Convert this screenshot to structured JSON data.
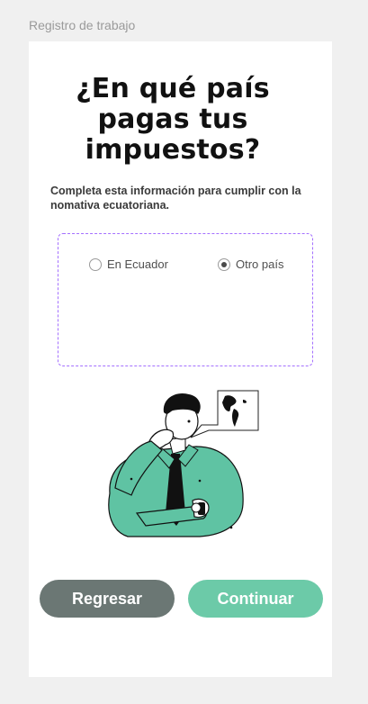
{
  "frame": {
    "label": "Registro de trabajo"
  },
  "screen": {
    "title": "¿En qué país pagas tus impuestos?",
    "subtitle": "Completa esta información para cumplir con la nomativa ecuatoriana."
  },
  "options": [
    {
      "label": "En Ecuador",
      "checked": false
    },
    {
      "label": "Otro país",
      "checked": true
    }
  ],
  "illustration": {
    "icon": "thinking-person-with-map-illustration"
  },
  "buttons": {
    "back_label": "Regresar",
    "next_label": "Continuar"
  },
  "colors": {
    "back_button": "#6b7774",
    "next_button": "#6ccaa8",
    "accent_dashed": "#a470ff",
    "shirt": "#5fc3a3"
  }
}
